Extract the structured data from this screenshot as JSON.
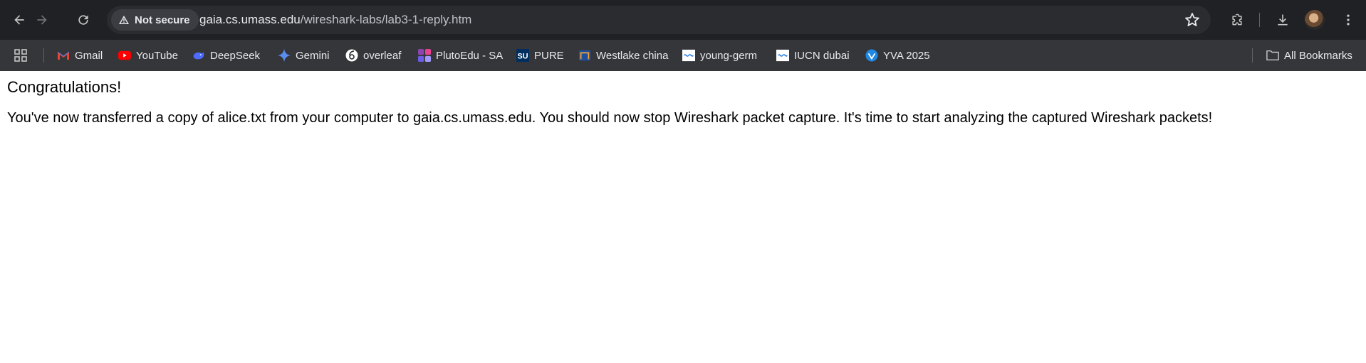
{
  "browser": {
    "security_chip": "Not secure",
    "url_host": "gaia.cs.umass.edu",
    "url_path": "/wireshark-labs/lab3-1-reply.htm"
  },
  "bookmarks": {
    "items": [
      {
        "label": "Gmail"
      },
      {
        "label": "YouTube"
      },
      {
        "label": "DeepSeek"
      },
      {
        "label": "Gemini"
      },
      {
        "label": "overleaf"
      },
      {
        "label": "PlutoEdu - SA"
      },
      {
        "label": "PURE"
      },
      {
        "label": "Westlake china"
      },
      {
        "label": "young-germ"
      },
      {
        "label": "IUCN dubai"
      },
      {
        "label": "YVA 2025"
      }
    ],
    "all_bookmarks": "All Bookmarks"
  },
  "page": {
    "heading": "Congratulations!",
    "body": "You've now transferred a copy of alice.txt from your computer to gaia.cs.umass.edu. You should now stop Wireshark packet capture. It's time to start analyzing the captured Wireshark packets!"
  },
  "icons": {
    "back": "arrow-left-icon",
    "forward": "arrow-right-icon",
    "reload": "reload-icon",
    "warning": "warning-triangle-icon",
    "star": "star-outline-icon",
    "extensions": "puzzle-icon",
    "downloads": "download-icon",
    "menu": "kebab-menu-icon",
    "apps": "apps-grid-icon",
    "folder": "folder-icon"
  }
}
